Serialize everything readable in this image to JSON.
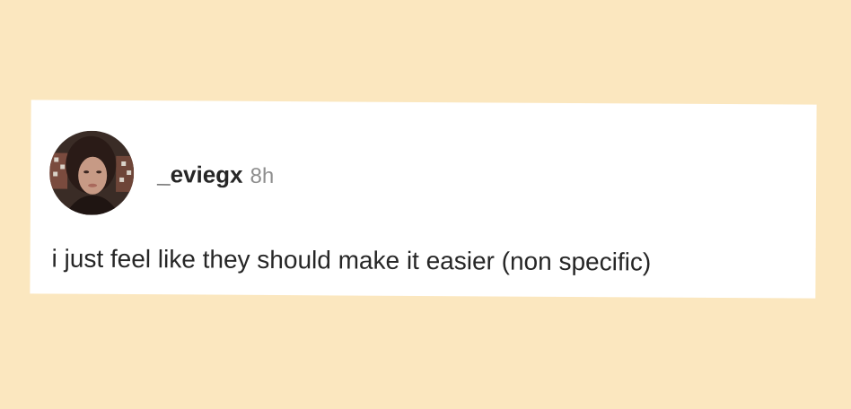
{
  "post": {
    "username": "_eviegx",
    "time": "8h",
    "text": "i just feel like they should make it easier (non specific)"
  },
  "colors": {
    "background": "#FBE7BF",
    "card": "#FFFFFF",
    "username": "#262626",
    "timestamp": "#8E8E8E",
    "text": "#262626"
  }
}
